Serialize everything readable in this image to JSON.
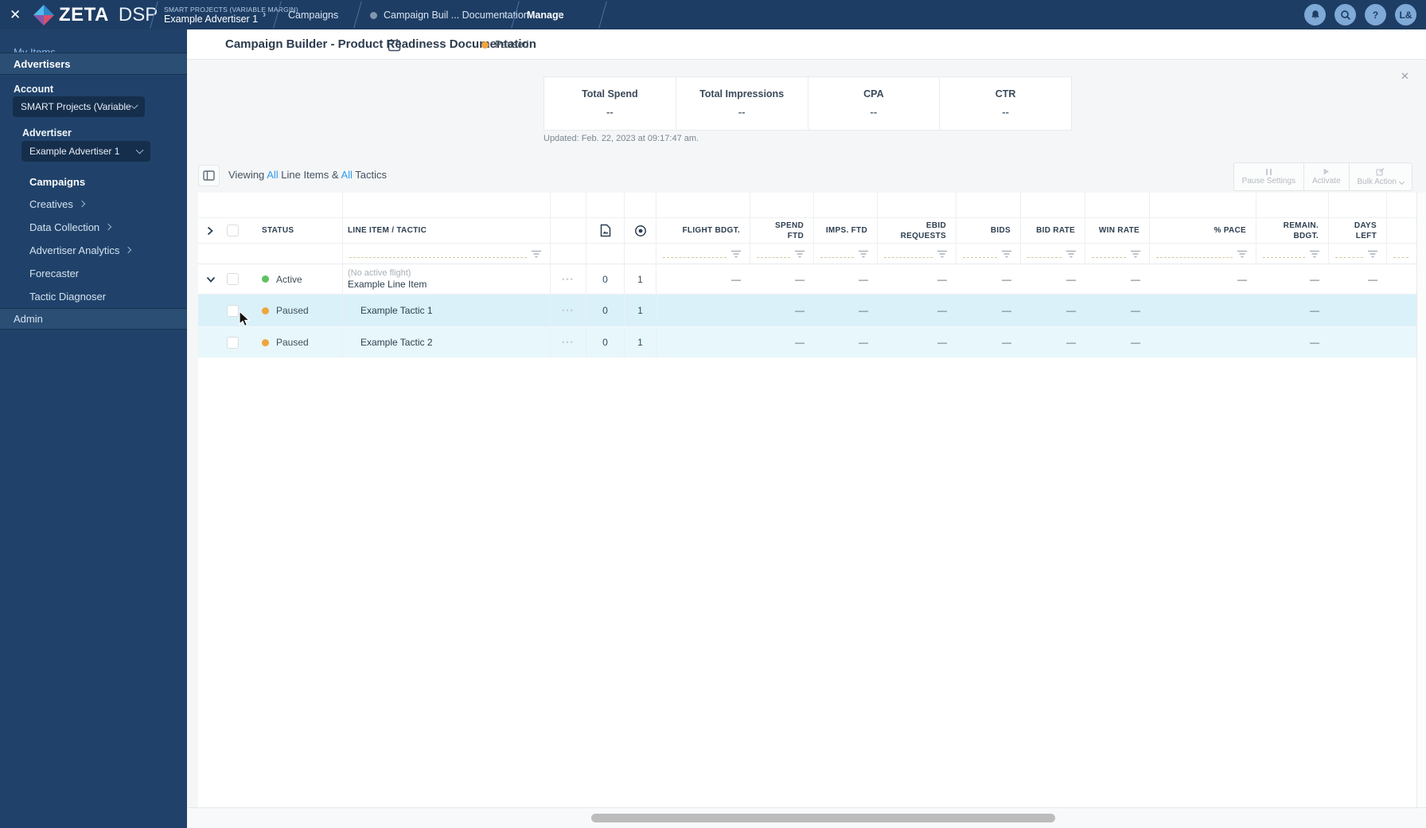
{
  "topbar": {
    "logo_zeta": "ZETA",
    "logo_dsp": "DSP",
    "crumb_account": "SMART PROJECTS (VARIABLE MARGIN)",
    "crumb_advertiser": "Example Advertiser 1",
    "crumb_campaigns": "Campaigns",
    "crumb_campaign": "Campaign Buil ... Documentation",
    "crumb_manage": "Manage",
    "avatar": "L&"
  },
  "icons": {
    "close": "✕",
    "sep": "›",
    "help": "?",
    "gear": "⚙",
    "more": "•••",
    "overview_close": "✕"
  },
  "sidebar": {
    "my_items": "My Items",
    "advertisers": "Advertisers",
    "account_label": "Account",
    "account_value": "SMART Projects (Variable M...",
    "advertiser_label": "Advertiser",
    "advertiser_value": "Example Advertiser 1",
    "items": [
      {
        "label": "Campaigns"
      },
      {
        "label": "Creatives"
      },
      {
        "label": "Data Collection"
      },
      {
        "label": "Advertiser Analytics"
      },
      {
        "label": "Forecaster"
      },
      {
        "label": "Tactic Diagnoser"
      }
    ],
    "admin": "Admin"
  },
  "header": {
    "title": "Campaign Builder - Product Readiness Documentation",
    "status": "Paused",
    "actions": "Actions"
  },
  "overview": {
    "metrics": [
      {
        "label": "Total Spend",
        "value": "--"
      },
      {
        "label": "Total Impressions",
        "value": "--"
      },
      {
        "label": "CPA",
        "value": "--"
      },
      {
        "label": "CTR",
        "value": "--"
      }
    ],
    "updated": "Updated: Feb. 22, 2023 at 09:17:47 am."
  },
  "toolbar": {
    "viewing_prefix": "Viewing",
    "all_1": "All",
    "mid": "Line Items &",
    "all_2": "All",
    "suffix": "Tactics",
    "pause_settings": "Pause Settings",
    "activate": "Activate",
    "bulk_action": "Bulk Action"
  },
  "table": {
    "headers": {
      "status": "STATUS",
      "line_item": "LINE ITEM / TACTIC",
      "flight_bdgt": "FLIGHT BDGT.",
      "spend_ftd": "SPEND\nFTD",
      "imps_ftd": "IMPS. FTD",
      "ebid_requests": "EBID\nREQUESTS",
      "bids": "BIDS",
      "bid_rate": "BID RATE",
      "win_rate": "WIN RATE",
      "pace": "% PACE",
      "remain_bdgt": "REMAIN.\nBDGT.",
      "days_left": "DAYS\nLEFT"
    },
    "rows": [
      {
        "status": "Active",
        "note": "(No active flight)",
        "name": "Example Line Item",
        "creatives": "0",
        "tactics": "1",
        "metrics": {
          "flight_bdgt": "—",
          "spend_ftd": "—",
          "imps_ftd": "—",
          "ebid_requests": "—",
          "bids": "—",
          "bid_rate": "—",
          "win_rate": "—",
          "pace": "—",
          "remain_bdgt": "—",
          "days_left": "—"
        }
      },
      {
        "status": "Paused",
        "name": "Example Tactic 1",
        "creatives": "0",
        "tactics": "1",
        "metrics": {
          "flight_bdgt": "",
          "spend_ftd": "—",
          "imps_ftd": "—",
          "ebid_requests": "—",
          "bids": "—",
          "bid_rate": "—",
          "win_rate": "—",
          "pace": "",
          "remain_bdgt": "—",
          "days_left": ""
        }
      },
      {
        "status": "Paused",
        "name": "Example Tactic 2",
        "creatives": "0",
        "tactics": "1",
        "metrics": {
          "flight_bdgt": "",
          "spend_ftd": "—",
          "imps_ftd": "—",
          "ebid_requests": "—",
          "bids": "—",
          "bid_rate": "—",
          "win_rate": "—",
          "pace": "",
          "remain_bdgt": "—",
          "days_left": ""
        }
      }
    ]
  },
  "colors": {
    "accent": "#2f9bf1",
    "status_paused": "#f0a43d",
    "status_active": "#5fc15f",
    "topbar": "#1d3d64"
  }
}
